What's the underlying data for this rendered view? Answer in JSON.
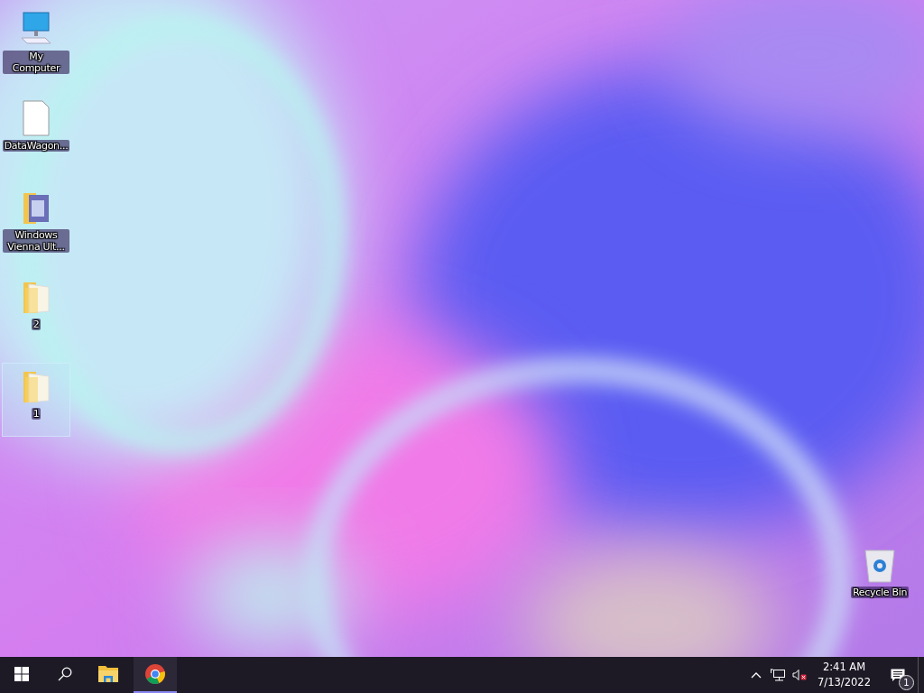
{
  "desktop_icons": [
    {
      "label": "My Computer",
      "kind": "computer",
      "selected": false
    },
    {
      "label": "DataWagon...",
      "kind": "file",
      "selected": false
    },
    {
      "label": "Windows Vienna Ult...",
      "kind": "image-folder",
      "selected": false
    },
    {
      "label": "2",
      "kind": "folder",
      "selected": false
    },
    {
      "label": "1",
      "kind": "folder",
      "selected": true
    }
  ],
  "recycle_bin": {
    "label": "Recycle Bin"
  },
  "taskbar": {
    "apps": [
      {
        "kind": "start",
        "selected": false
      },
      {
        "kind": "search",
        "selected": false
      },
      {
        "kind": "explorer",
        "selected": false
      },
      {
        "kind": "chrome",
        "selected": true
      }
    ],
    "tray": {
      "volume_muted": true,
      "time": "2:41 AM",
      "date": "7/13/2022",
      "notification_count": "1"
    }
  }
}
